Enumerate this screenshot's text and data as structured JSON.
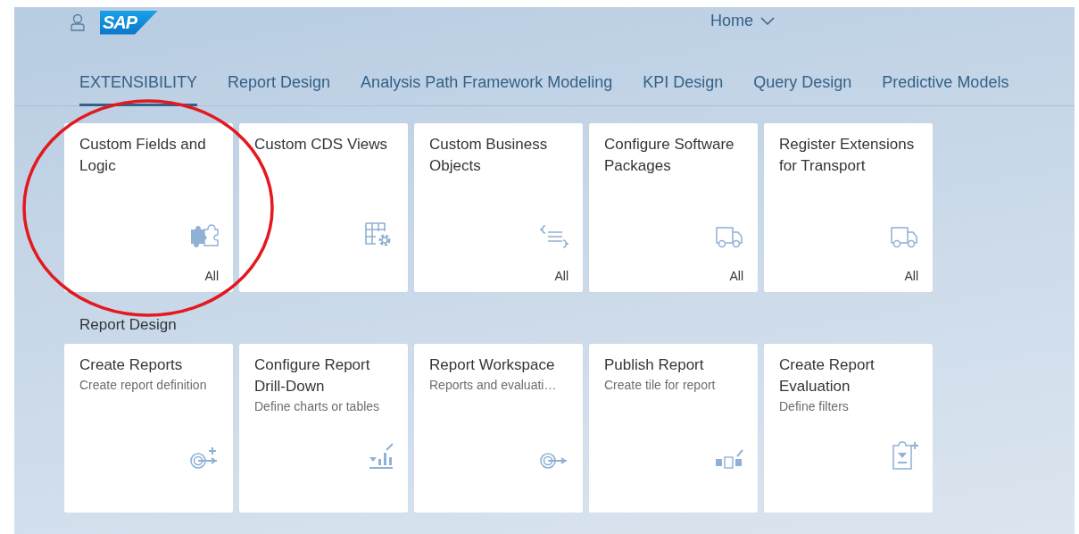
{
  "header": {
    "logo": "SAP",
    "title": "Home"
  },
  "tabs": [
    {
      "label": "EXTENSIBILITY",
      "selected": true
    },
    {
      "label": "Report Design",
      "selected": false
    },
    {
      "label": "Analysis Path Framework Modeling",
      "selected": false
    },
    {
      "label": "KPI Design",
      "selected": false
    },
    {
      "label": "Query Design",
      "selected": false
    },
    {
      "label": "Predictive Models",
      "selected": false
    }
  ],
  "sections": [
    {
      "tiles": [
        {
          "title": "Custom Fields and Logic",
          "footer": "All"
        },
        {
          "title": "Custom CDS Views"
        },
        {
          "title": "Custom Business Objects",
          "footer": "All"
        },
        {
          "title": "Configure Software Packages",
          "footer": "All"
        },
        {
          "title": "Register Extensions for Transport",
          "footer": "All"
        }
      ]
    },
    {
      "title": "Report Design",
      "tiles": [
        {
          "title": "Create Reports",
          "subtitle": "Create report definition"
        },
        {
          "title": "Configure Report Drill-Down",
          "subtitle": "Define charts or tables"
        },
        {
          "title": "Report Workspace",
          "subtitle": "Reports and evaluati…"
        },
        {
          "title": "Publish Report",
          "subtitle": "Create tile for report"
        },
        {
          "title": "Create Report Evaluation",
          "subtitle": "Define filters"
        }
      ]
    }
  ]
}
